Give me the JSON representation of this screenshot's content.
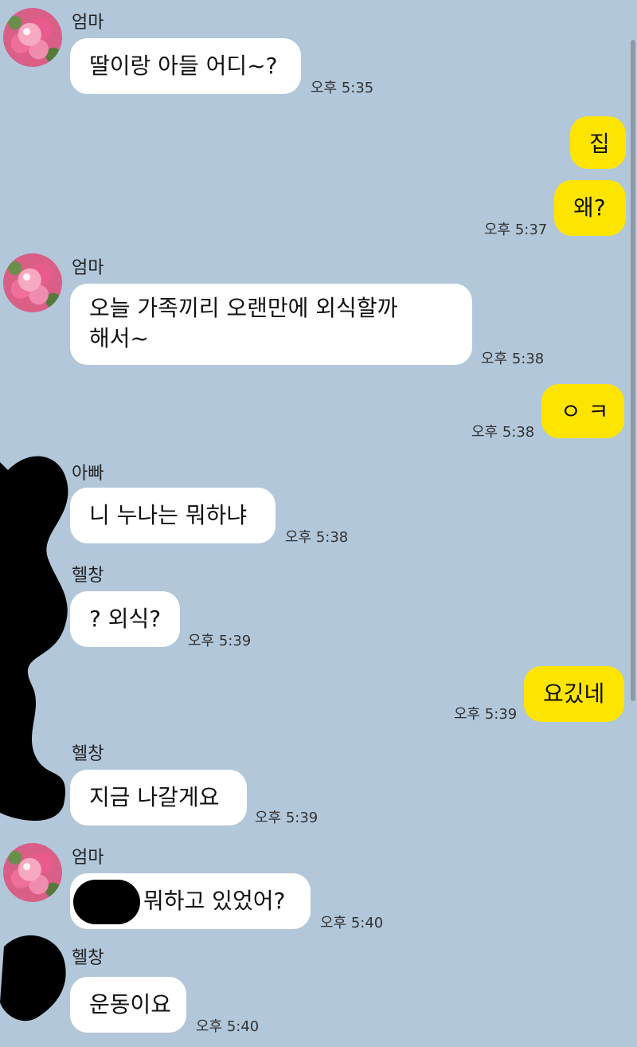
{
  "messages": [
    {
      "sender": "엄마",
      "text": "딸이랑 아들 어디~?",
      "time": "오후 5:35"
    },
    {
      "text": "집"
    },
    {
      "text": "왜?",
      "time": "오후 5:37"
    },
    {
      "sender": "엄마",
      "text": "오늘 가족끼리 오랜만에 외식할까",
      "text2": "해서~",
      "time": "오후 5:38"
    },
    {
      "text": "ㅇ ㅋ",
      "time": "오후 5:38"
    },
    {
      "sender": "아빠",
      "text": "니 누나는 뭐하냐",
      "time": "오후 5:38"
    },
    {
      "sender": "헬창",
      "text": "? 외식?",
      "time": "오후 5:39"
    },
    {
      "text": "요깄네",
      "time": "오후 5:39"
    },
    {
      "sender": "헬창",
      "text": "지금 나갈게요",
      "time": "오후 5:39"
    },
    {
      "sender": "엄마",
      "text": "뭐하고 있었어?",
      "time": "오후 5:40"
    },
    {
      "sender": "헬창",
      "text": "운동이요",
      "time": "오후 5:40"
    }
  ],
  "colors": {
    "background": "#b2c7da",
    "my_bubble": "#fee500",
    "other_bubble": "#ffffff"
  }
}
